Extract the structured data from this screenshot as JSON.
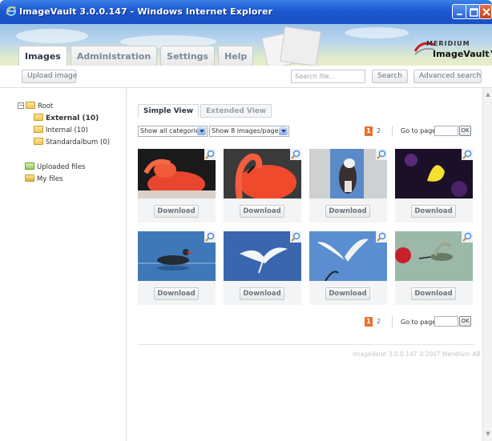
{
  "window": {
    "title": "ImageVault 3.0.0.147 - Windows Internet Explorer"
  },
  "nav": {
    "tabs": [
      "Images",
      "Administration",
      "Settings",
      "Help"
    ],
    "active_tab": "Images"
  },
  "logo": {
    "line1": "MERIDIUM",
    "line2": "ImageVault™"
  },
  "toolbar": {
    "upload_label": "Upload image",
    "search_placeholder": "Search file...",
    "search_label": "Search",
    "advanced_search_label": "Advanced search"
  },
  "sidebar": {
    "root_label": "Root",
    "folders": [
      {
        "label": "External (10)",
        "selected": true
      },
      {
        "label": "Internal (10)",
        "selected": false
      },
      {
        "label": "Standardalbum (0)",
        "selected": false
      }
    ],
    "uploaded_label": "Uploaded files",
    "my_files_label": "My files"
  },
  "view_tabs": [
    "Simple View",
    "Extended View"
  ],
  "active_view": "Simple View",
  "filters": {
    "category": "Show all categories",
    "per_page": "Show 8 images/page"
  },
  "pagination": {
    "current": "1",
    "next": "2",
    "goto_label": "Go to page",
    "ok_label": "OK"
  },
  "images": [
    {
      "subject": "flamingo-sleeping",
      "download": "Download"
    },
    {
      "subject": "flamingo-closeup",
      "download": "Download"
    },
    {
      "subject": "eagle",
      "download": "Download"
    },
    {
      "subject": "yellow-butterfly",
      "download": "Download"
    },
    {
      "subject": "moorhen",
      "download": "Download"
    },
    {
      "subject": "egret-flying",
      "download": "Download"
    },
    {
      "subject": "egret-landing",
      "download": "Download"
    },
    {
      "subject": "hummingbird",
      "download": "Download"
    }
  ],
  "footer": "ImageVault 3.0.0.147 ©2007 Meridium AB"
}
